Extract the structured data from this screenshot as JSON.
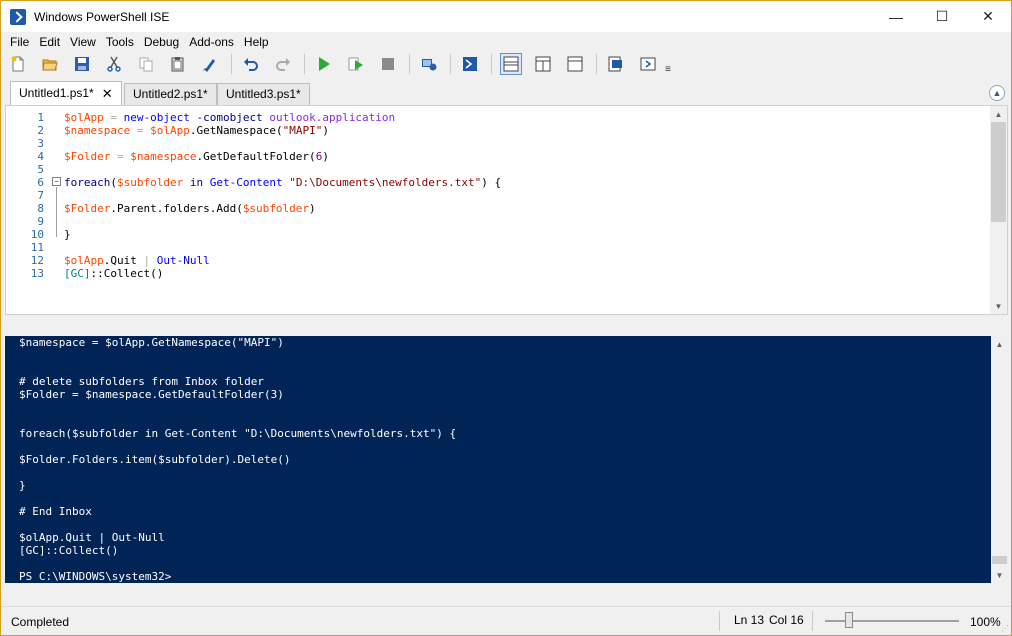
{
  "window": {
    "title": "Windows PowerShell ISE",
    "minimize": "—",
    "maximize": "☐",
    "close": "✕"
  },
  "menu": [
    "File",
    "Edit",
    "View",
    "Tools",
    "Debug",
    "Add-ons",
    "Help"
  ],
  "tabs": [
    {
      "label": "Untitled1.ps1*",
      "close": "✕",
      "active": true
    },
    {
      "label": "Untitled2.ps1*",
      "active": false
    },
    {
      "label": "Untitled3.ps1*",
      "active": false
    }
  ],
  "editor": {
    "line_numbers": [
      "1",
      "2",
      "3",
      "4",
      "5",
      "6",
      "7",
      "8",
      "9",
      "10",
      "11",
      "12",
      "13"
    ],
    "lines": [
      [
        {
          "t": "$olApp",
          "c": "var"
        },
        {
          "t": " = ",
          "c": "op"
        },
        {
          "t": "new-object",
          "c": "cmd"
        },
        {
          "t": " -comobject ",
          "c": "kw"
        },
        {
          "t": "outlook.application",
          "c": "txt"
        }
      ],
      [
        {
          "t": "$namespace",
          "c": "var"
        },
        {
          "t": " = ",
          "c": "op"
        },
        {
          "t": "$olApp",
          "c": "var"
        },
        {
          "t": ".GetNamespace(",
          "c": "mem"
        },
        {
          "t": "\"MAPI\"",
          "c": "str"
        },
        {
          "t": ")",
          "c": "mem"
        }
      ],
      [],
      [
        {
          "t": "$Folder",
          "c": "var"
        },
        {
          "t": " = ",
          "c": "op"
        },
        {
          "t": "$namespace",
          "c": "var"
        },
        {
          "t": ".GetDefaultFolder(",
          "c": "mem"
        },
        {
          "t": "6",
          "c": "num"
        },
        {
          "t": ")",
          "c": "mem"
        }
      ],
      [],
      [
        {
          "t": "foreach",
          "c": "kw"
        },
        {
          "t": "(",
          "c": "mem"
        },
        {
          "t": "$subfolder",
          "c": "var"
        },
        {
          "t": " in ",
          "c": "kw"
        },
        {
          "t": "Get-Content",
          "c": "cmd"
        },
        {
          "t": " ",
          "c": "mem"
        },
        {
          "t": "\"D:\\Documents\\newfolders.txt\"",
          "c": "str"
        },
        {
          "t": ") {",
          "c": "mem"
        }
      ],
      [],
      [
        {
          "t": "$Folder",
          "c": "var"
        },
        {
          "t": ".Parent.folders.Add(",
          "c": "mem"
        },
        {
          "t": "$subfolder",
          "c": "var"
        },
        {
          "t": ")",
          "c": "mem"
        }
      ],
      [],
      [
        {
          "t": "}",
          "c": "mem"
        }
      ],
      [],
      [
        {
          "t": "$olApp",
          "c": "var"
        },
        {
          "t": ".Quit ",
          "c": "mem"
        },
        {
          "t": "| ",
          "c": "op"
        },
        {
          "t": "Out-Null",
          "c": "cmd"
        }
      ],
      [
        {
          "t": "[GC]",
          "c": "typ"
        },
        {
          "t": "::Collect()",
          "c": "mem"
        }
      ]
    ]
  },
  "console": {
    "lines": [
      "$namespace = $olApp.GetNamespace(\"MAPI\")",
      "",
      "",
      "# delete subfolders from Inbox folder",
      "$Folder = $namespace.GetDefaultFolder(3)",
      "",
      "",
      "foreach($subfolder in Get-Content \"D:\\Documents\\newfolders.txt\") {",
      "",
      "$Folder.Folders.item($subfolder).Delete()",
      "",
      "}",
      "",
      "# End Inbox",
      "",
      "$olApp.Quit | Out-Null",
      "[GC]::Collect()",
      "",
      "PS C:\\WINDOWS\\system32>"
    ]
  },
  "status": {
    "text": "Completed",
    "line": "Ln 13",
    "column": "Col 16",
    "zoom": "100%",
    "zoom_level": 0.18
  }
}
